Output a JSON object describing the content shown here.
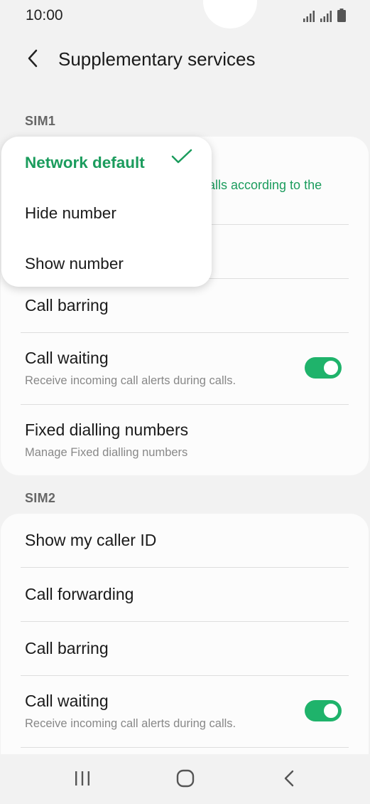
{
  "status_bar": {
    "time": "10:00",
    "icons": [
      "signal-icon",
      "signal-icon",
      "battery-icon"
    ]
  },
  "header": {
    "title": "Supplementary services",
    "back_icon": "chevron-left-icon"
  },
  "sim1": {
    "label": "SIM1",
    "caller_id_partial": "alls according to the",
    "rows": [
      {
        "title": "Call barring"
      },
      {
        "title": "Call waiting",
        "subtitle": "Receive incoming call alerts during calls.",
        "toggle": true
      },
      {
        "title": "Fixed dialling numbers",
        "subtitle": "Manage Fixed dialling numbers"
      }
    ]
  },
  "popup": {
    "options": [
      {
        "label": "Network default",
        "selected": true
      },
      {
        "label": "Hide number",
        "selected": false
      },
      {
        "label": "Show number",
        "selected": false
      }
    ]
  },
  "sim2": {
    "label": "SIM2",
    "rows": [
      {
        "title": "Show my caller ID"
      },
      {
        "title": "Call forwarding"
      },
      {
        "title": "Call barring"
      },
      {
        "title": "Call waiting",
        "subtitle": "Receive incoming call alerts during calls.",
        "toggle": true
      }
    ]
  },
  "nav": {
    "items": [
      "recent-apps-icon",
      "home-icon",
      "back-icon"
    ]
  },
  "colors": {
    "accent": "#1b9c5d",
    "toggle_on": "#1fb36b",
    "background": "#f2f2f2",
    "card": "#fcfcfc"
  }
}
